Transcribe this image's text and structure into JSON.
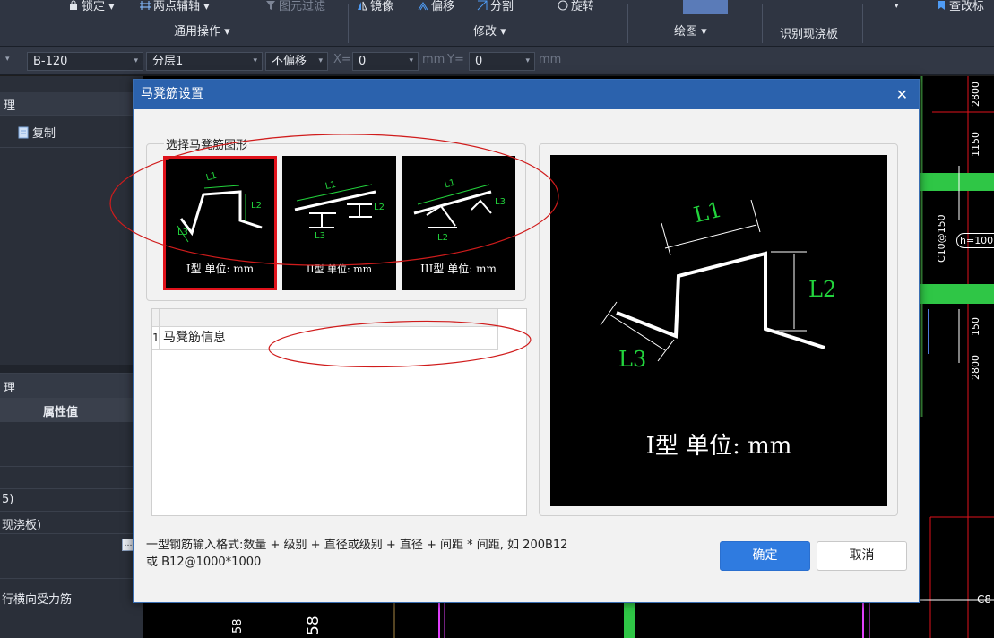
{
  "ribbon": {
    "items": [
      {
        "label": "锁定",
        "icon": "lock-icon"
      },
      {
        "label": "两点辅轴",
        "icon": "axis-icon"
      },
      {
        "label": "图元过滤",
        "icon": "filter-icon"
      },
      {
        "label": "镜像",
        "icon": "mirror-icon"
      },
      {
        "label": "偏移",
        "icon": "offset-icon"
      },
      {
        "label": "分割",
        "icon": "split-icon"
      },
      {
        "label": "旋转",
        "icon": "rotate-icon"
      },
      {
        "label": "查改标",
        "icon": "edit-tag-icon"
      }
    ],
    "groups": {
      "common": "通用操作",
      "modify": "修改",
      "draw": "绘图",
      "identify": "识别现浇板"
    }
  },
  "propbar": {
    "component": "B-120",
    "layer": "分层1",
    "offset_mode": "不偏移",
    "x_label": "X=",
    "x_value": "0",
    "y_label": "Y=",
    "y_value": "0",
    "unit": "mm"
  },
  "left_panel": {
    "copy_label": "复制",
    "prop_header": "属性值",
    "row_frag1": "5)",
    "row_frag2": "现浇板)",
    "row_frag3": "行横向受力筋",
    "tab_frag": "理"
  },
  "canvas": {
    "labels": [
      "2800",
      "1150",
      "C10@150",
      "h=100",
      "150",
      "2800",
      "C8",
      "58",
      "58"
    ]
  },
  "dialog": {
    "title": "马凳筋设置",
    "group_title": "选择马凳筋图形",
    "shapes": [
      {
        "label": "I型 单位: mm",
        "selected": true
      },
      {
        "label": "II型 单位: mm",
        "selected": false
      },
      {
        "label": "III型 单位: mm",
        "selected": false
      }
    ],
    "dims": {
      "l1": "L1",
      "l2": "L2",
      "l3": "L3"
    },
    "grid": {
      "row_num": "1",
      "row_name": "马凳筋信息",
      "row_value": ""
    },
    "preview_label": "I型 单位: mm",
    "hint_line1": "一型钢筋输入格式:数量 + 级别 + 直径或级别 + 直径 + 间距 * 间距, 如 200B12",
    "hint_line2": "或 B12@1000*1000",
    "ok": "确定",
    "cancel": "取消"
  },
  "colors": {
    "accent": "#2b62ad",
    "ok_button": "#2f7be0",
    "dim_green": "#22d33c",
    "selection_red": "#e0121b",
    "annotation_red": "#d01c1c"
  }
}
